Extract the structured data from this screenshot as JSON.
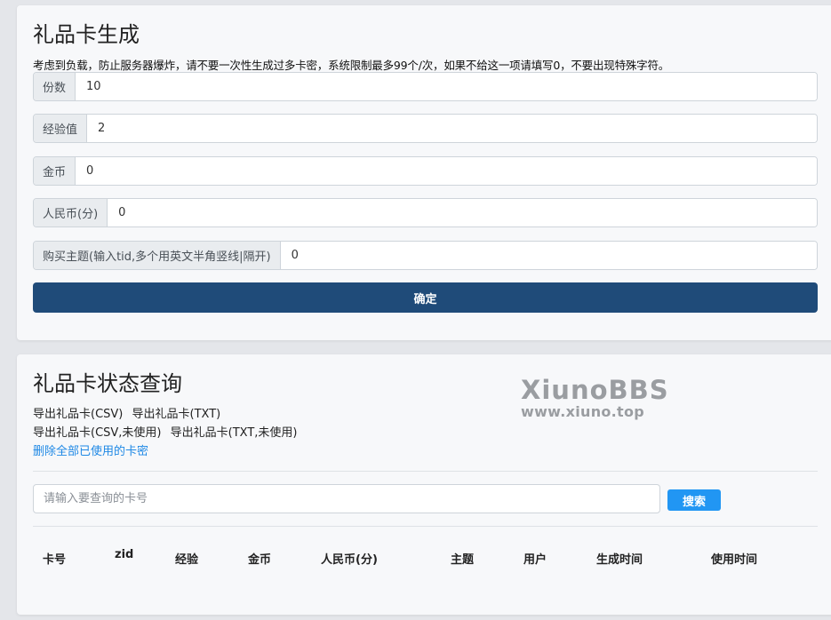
{
  "generate": {
    "title": "礼品卡生成",
    "notice": "考虑到负载，防止服务器爆炸，请不要一次性生成过多卡密，系统限制最多99个/次，如果不给这一项请填写0，不要出现特殊字符。",
    "fields": [
      {
        "label": "份数",
        "value": "10"
      },
      {
        "label": "经验值",
        "value": "2"
      },
      {
        "label": "金币",
        "value": "0"
      },
      {
        "label": "人民币(分)",
        "value": "0"
      },
      {
        "label": "购买主题(输入tid,多个用英文半角竖线|隔开)",
        "value": "0"
      }
    ],
    "submit_label": "确定"
  },
  "query": {
    "title": "礼品卡状态查询",
    "links": {
      "export_csv": "导出礼品卡(CSV)",
      "export_txt": "导出礼品卡(TXT)",
      "export_csv_unused": "导出礼品卡(CSV,未使用)",
      "export_txt_unused": "导出礼品卡(TXT,未使用)",
      "delete_used": "删除全部已使用的卡密"
    },
    "watermark": {
      "main": "XiunoBBS",
      "sub": "www.xiuno.top"
    },
    "search": {
      "placeholder": "请输入要查询的卡号",
      "button_label": "搜索"
    },
    "table_headers": [
      "卡号",
      "zid",
      "经验",
      "金币",
      "人民币(分)",
      "主题",
      "用户",
      "生成时间",
      "使用时间"
    ]
  },
  "colors": {
    "page_bg": "#e4e6ea",
    "card_bg": "#f7f8fa",
    "primary_button": "#1f4b79",
    "search_button": "#2196f3",
    "link_blue": "#1e88e5"
  }
}
